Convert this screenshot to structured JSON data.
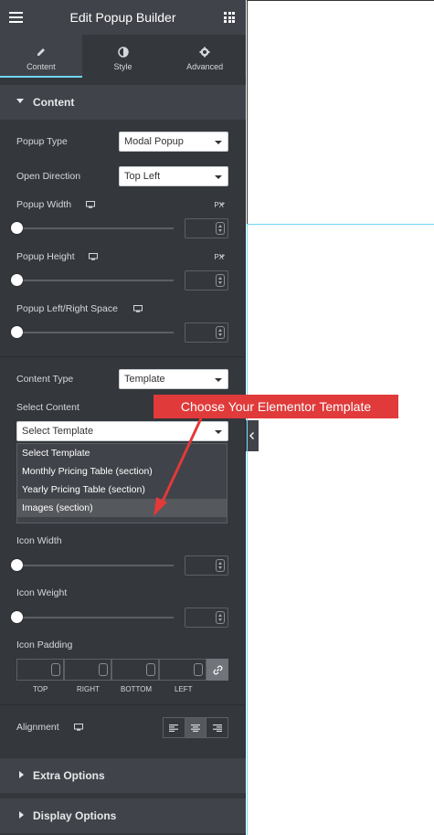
{
  "header": {
    "title": "Edit Popup Builder"
  },
  "tabs": [
    {
      "label": "Content",
      "icon": "pencil-icon"
    },
    {
      "label": "Style",
      "icon": "half-circle-icon"
    },
    {
      "label": "Advanced",
      "icon": "gear-icon"
    }
  ],
  "content_section": {
    "title": "Content",
    "popup_type": {
      "label": "Popup Type",
      "value": "Modal Popup"
    },
    "open_direction": {
      "label": "Open Direction",
      "value": "Top Left"
    },
    "popup_width": {
      "label": "Popup Width",
      "unit": "PX"
    },
    "popup_height": {
      "label": "Popup Height",
      "unit": "PX"
    },
    "popup_space": {
      "label": "Popup Left/Right Space"
    },
    "content_type": {
      "label": "Content Type",
      "value": "Template"
    },
    "select_content": {
      "label": "Select Content",
      "value": "Select Template",
      "options": [
        "Select Template",
        "Monthly Pricing Table (section)",
        "Yearly Pricing Table (section)",
        "Images (section)"
      ]
    },
    "icon_width": {
      "label": "Icon Width"
    },
    "icon_weight": {
      "label": "Icon Weight"
    },
    "icon_padding": {
      "label": "Icon Padding",
      "sides": [
        "TOP",
        "RIGHT",
        "BOTTOM",
        "LEFT"
      ]
    },
    "alignment": {
      "label": "Alignment"
    }
  },
  "sections": [
    {
      "title": "Extra Options"
    },
    {
      "title": "Display Options"
    }
  ],
  "callout": {
    "text": "Choose Your Elementor Template"
  },
  "colors": {
    "panel": "#34373c",
    "header": "#404349",
    "accent": "#71d7f7",
    "callout": "#e03a3a"
  }
}
